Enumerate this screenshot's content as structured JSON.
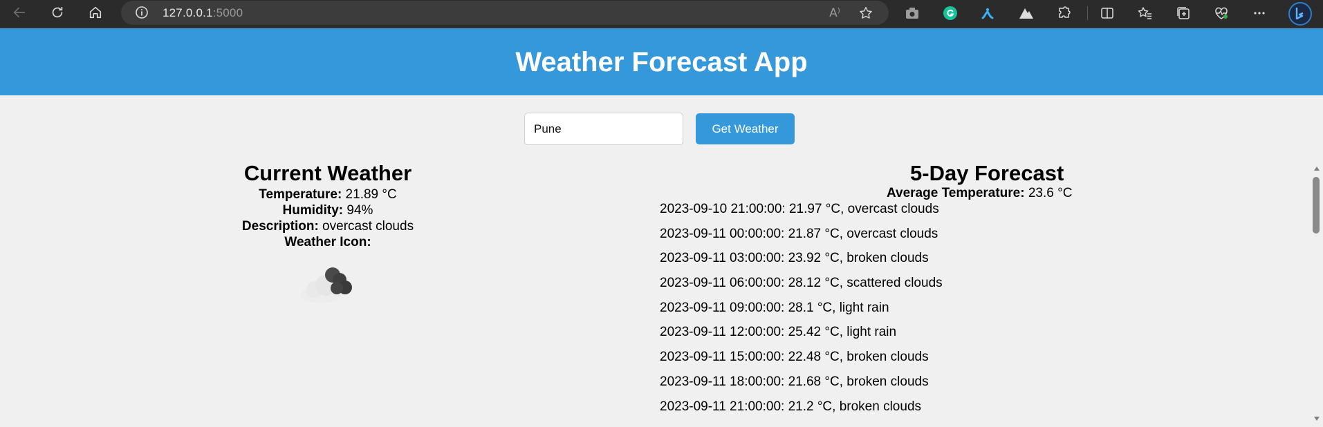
{
  "browser": {
    "url_host": "127.0.0.1",
    "url_port": ":5000",
    "read_aloud_label": "A⁾",
    "icons": [
      "back-icon",
      "refresh-icon",
      "home-icon",
      "info-icon",
      "read-aloud-icon",
      "favorite-star-icon",
      "camera-icon",
      "grammarly-icon",
      "extension-icon",
      "mountain-icon",
      "extensions-puzzle-icon",
      "split-screen-icon",
      "favorites-icon",
      "collections-icon",
      "browser-essentials-icon",
      "more-icon",
      "bing-copilot-icon"
    ]
  },
  "header": {
    "title": "Weather Forecast App",
    "bg_color": "#3498db"
  },
  "search": {
    "city_value": "Pune",
    "button_label": "Get Weather"
  },
  "current": {
    "title": "Current Weather",
    "temperature_label": "Temperature:",
    "temperature_value": " 21.89 °C",
    "humidity_label": "Humidity:",
    "humidity_value": " 94%",
    "description_label": "Description:",
    "description_value": " overcast clouds",
    "icon_label": "Weather Icon:",
    "icon_name": "overcast-clouds-icon"
  },
  "forecast": {
    "title": "5-Day Forecast",
    "avg_label": "Average Temperature:",
    "avg_value": " 23.6 °C",
    "items": [
      "2023-09-10 21:00:00: 21.97 °C, overcast clouds",
      "2023-09-11 00:00:00: 21.87 °C, overcast clouds",
      "2023-09-11 03:00:00: 23.92 °C, broken clouds",
      "2023-09-11 06:00:00: 28.12 °C, scattered clouds",
      "2023-09-11 09:00:00: 28.1 °C, light rain",
      "2023-09-11 12:00:00: 25.42 °C, light rain",
      "2023-09-11 15:00:00: 22.48 °C, broken clouds",
      "2023-09-11 18:00:00: 21.68 °C, broken clouds",
      "2023-09-11 21:00:00: 21.2 °C, broken clouds"
    ]
  }
}
